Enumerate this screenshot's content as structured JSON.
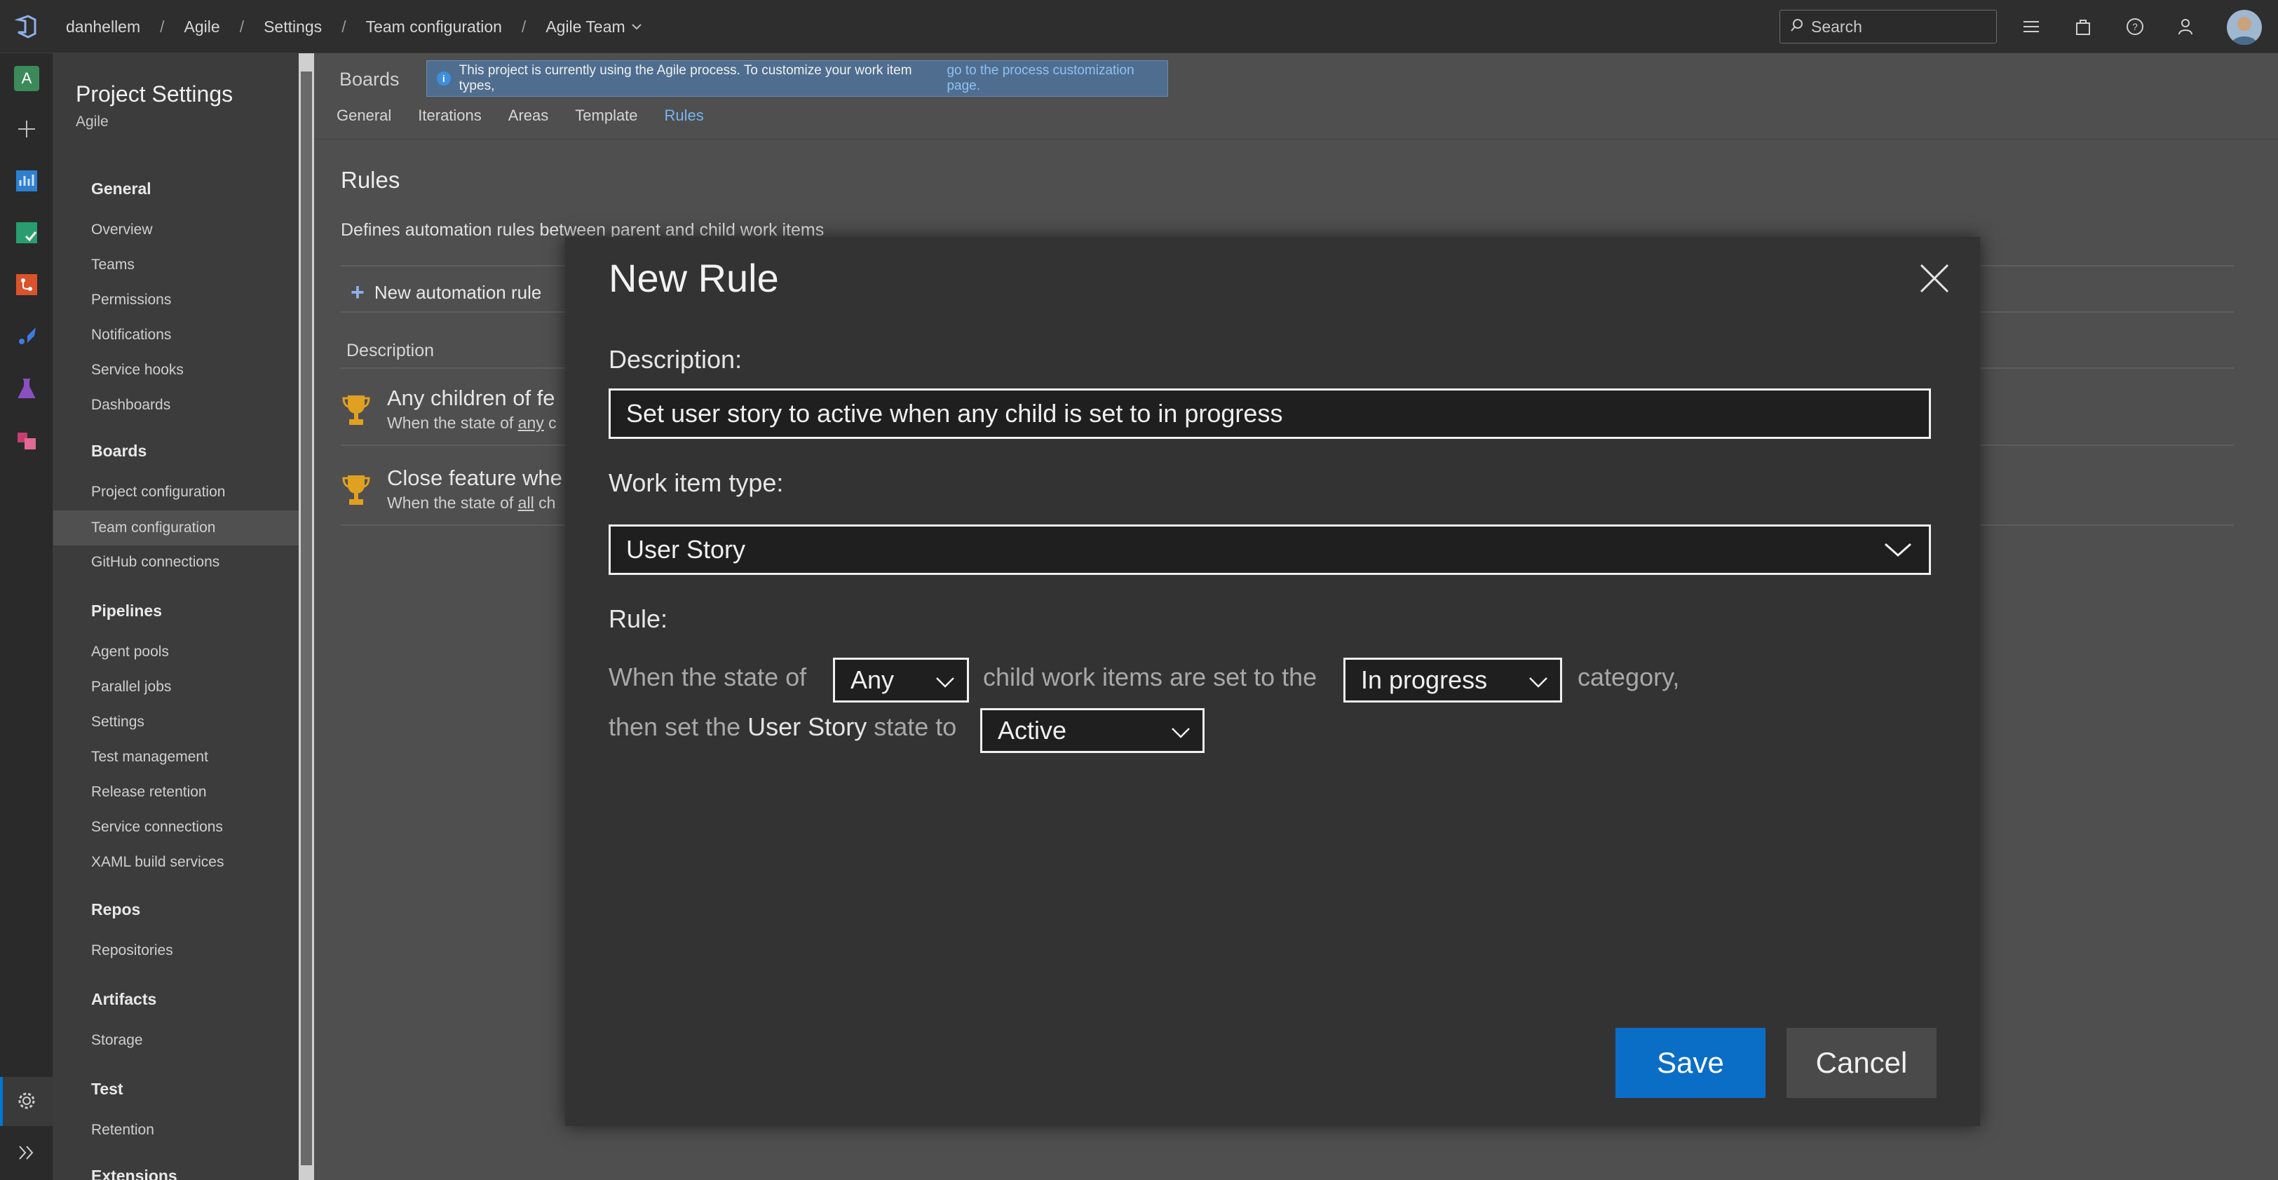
{
  "topbar": {
    "breadcrumbs": [
      "danhellem",
      "Agile",
      "Settings",
      "Team configuration",
      "Agile Team"
    ],
    "search_placeholder": "Search"
  },
  "sidebar": {
    "title": "Project Settings",
    "subtitle": "Agile",
    "groups": [
      {
        "label": "General",
        "items": [
          "Overview",
          "Teams",
          "Permissions",
          "Notifications",
          "Service hooks",
          "Dashboards"
        ]
      },
      {
        "label": "Boards",
        "items": [
          "Project configuration",
          "Team configuration",
          "GitHub connections"
        ]
      },
      {
        "label": "Pipelines",
        "items": [
          "Agent pools",
          "Parallel jobs",
          "Settings",
          "Test management",
          "Release retention",
          "Service connections",
          "XAML build services"
        ]
      },
      {
        "label": "Repos",
        "items": [
          "Repositories"
        ]
      },
      {
        "label": "Artifacts",
        "items": [
          "Storage"
        ]
      },
      {
        "label": "Test",
        "items": [
          "Retention"
        ]
      },
      {
        "label": "Extensions",
        "items": []
      }
    ],
    "active_item": "Team configuration"
  },
  "main": {
    "section": "Boards",
    "banner_text": "This project is currently using the Agile process. To customize your work item types,",
    "banner_link": "go to the process customization page.",
    "tabs": [
      "General",
      "Iterations",
      "Areas",
      "Template",
      "Rules"
    ],
    "active_tab": "Rules",
    "rules_title": "Rules",
    "rules_description": "Defines automation rules between parent and child work items",
    "new_rule_label": "New automation rule",
    "column_header": "Description",
    "rules": [
      {
        "title": "Any children of fe",
        "subtitle_pre": "When the state of ",
        "subtitle_em": "any",
        "subtitle_post": " c"
      },
      {
        "title": "Close feature whe",
        "subtitle_pre": "When the state of ",
        "subtitle_em": "all",
        "subtitle_post": " ch"
      }
    ]
  },
  "modal": {
    "title": "New Rule",
    "description_label": "Description:",
    "description_value": "Set user story to active when any child is set to in progress",
    "work_item_type_label": "Work item type:",
    "work_item_type_value": "User Story",
    "rule_label": "Rule:",
    "rule_text_1": "When the state of",
    "rule_any_value": "Any",
    "rule_text_2": "child work items are set to the",
    "rule_category_value": "In progress",
    "rule_text_3": "category,",
    "rule_text_4": "then set the",
    "rule_type_name": "User Story",
    "rule_text_5": "state to",
    "rule_state_value": "Active",
    "save_label": "Save",
    "cancel_label": "Cancel"
  },
  "colors": {
    "accent": "#0a6ec7",
    "link": "#79b4f2"
  }
}
